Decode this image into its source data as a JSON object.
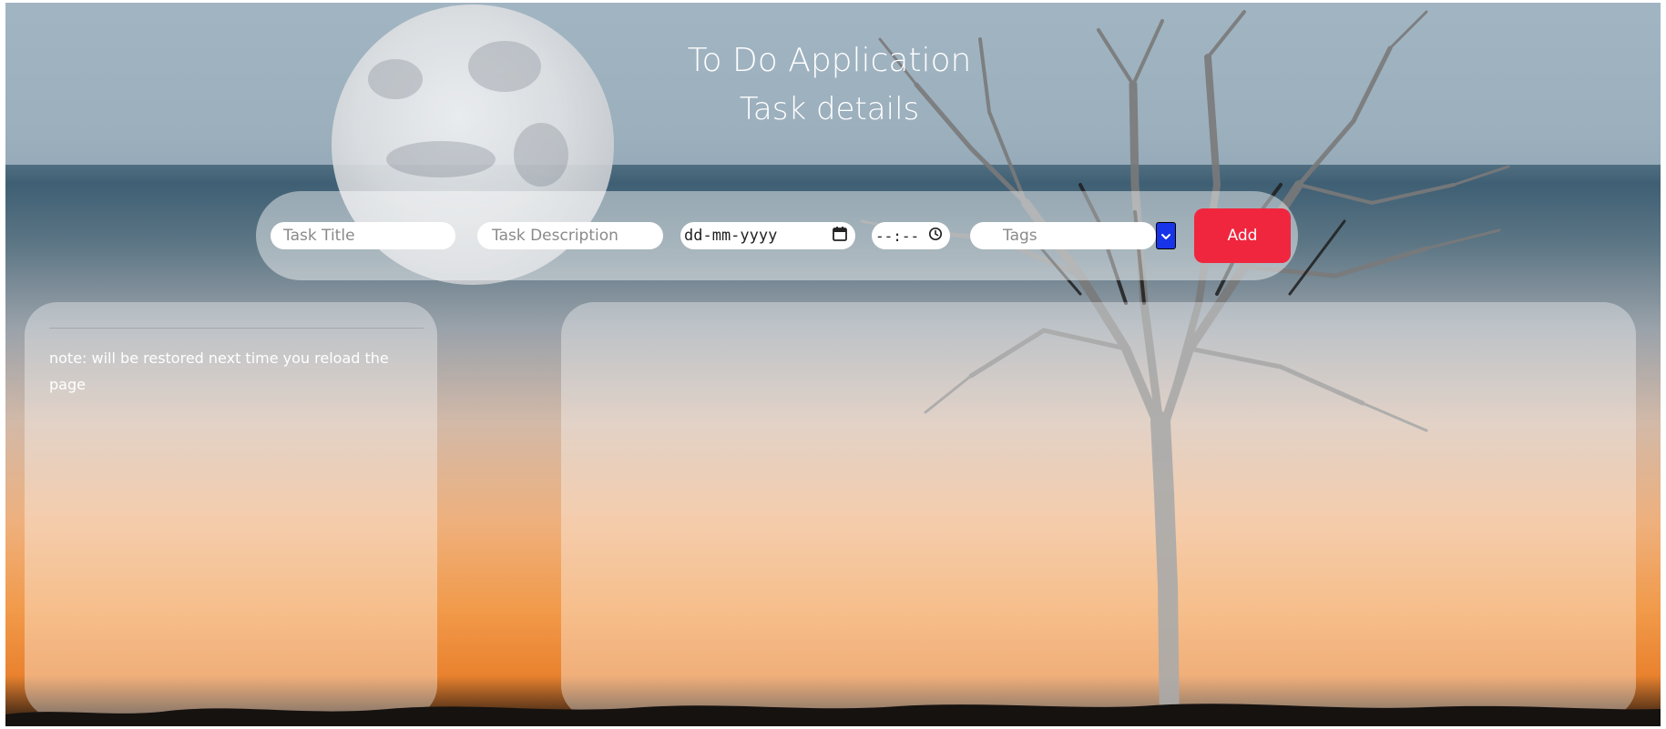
{
  "header": {
    "title": "To Do Application",
    "subtitle": "Task details"
  },
  "form": {
    "title_placeholder": "Task  Title",
    "description_placeholder": "Task  Description",
    "date_placeholder": "dd-mm-yyyy",
    "time_placeholder": "--:--",
    "tags_placeholder": "Tags",
    "add_label": "Add"
  },
  "panel_left": {
    "note": "note: will be restored next time you reload the page"
  },
  "icons": {
    "date": "calendar-icon",
    "time": "clock-icon",
    "dropdown": "chevron-down-icon"
  },
  "colors": {
    "accent": "#f0263f",
    "dropdown": "#1834e8"
  }
}
